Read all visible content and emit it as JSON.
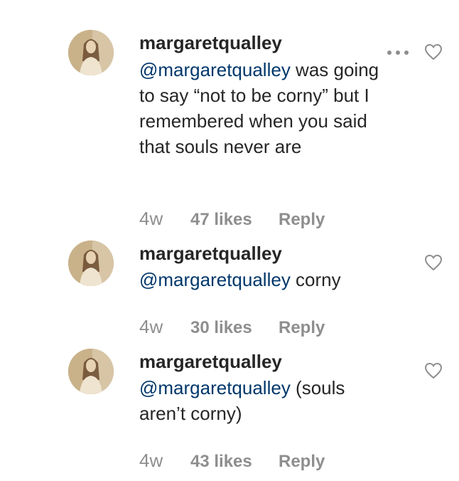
{
  "comments": [
    {
      "username": "margaretqualley",
      "mention": "@margaretqualley",
      "text": " was going to say “not to be corny” but I remembered when you said that souls never are",
      "time": "4w",
      "likes": "47 likes",
      "reply": "Reply"
    },
    {
      "username": "margaretqualley",
      "mention": "@margaretqualley",
      "text": " corny",
      "time": "4w",
      "likes": "30 likes",
      "reply": "Reply"
    },
    {
      "username": "margaretqualley",
      "mention": "@margaretqualley",
      "text": " (souls aren’t corny)",
      "time": "4w",
      "likes": "43 likes",
      "reply": "Reply"
    }
  ],
  "icons": {
    "more": "more-options-icon",
    "like": "heart-icon"
  },
  "colors": {
    "text": "#262626",
    "mention": "#00376b",
    "meta": "#8e8e8e"
  }
}
